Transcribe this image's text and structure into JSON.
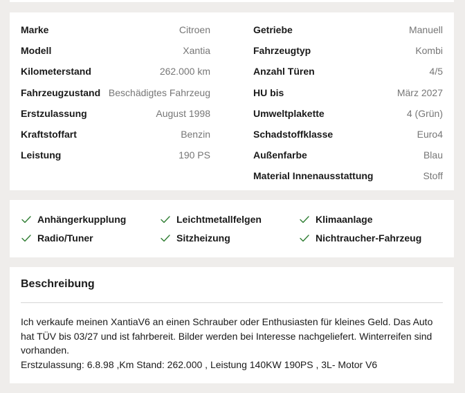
{
  "details": {
    "left": [
      {
        "label": "Marke",
        "value": "Citroen"
      },
      {
        "label": "Modell",
        "value": "Xantia"
      },
      {
        "label": "Kilometerstand",
        "value": "262.000 km"
      },
      {
        "label": "Fahrzeugzustand",
        "value": "Beschädigtes Fahrzeug"
      },
      {
        "label": "Erstzulassung",
        "value": "August 1998"
      },
      {
        "label": "Kraftstoffart",
        "value": "Benzin"
      },
      {
        "label": "Leistung",
        "value": "190 PS"
      }
    ],
    "right": [
      {
        "label": "Getriebe",
        "value": "Manuell"
      },
      {
        "label": "Fahrzeugtyp",
        "value": "Kombi"
      },
      {
        "label": "Anzahl Türen",
        "value": "4/5"
      },
      {
        "label": "HU bis",
        "value": "März 2027"
      },
      {
        "label": "Umweltplakette",
        "value": "4 (Grün)"
      },
      {
        "label": "Schadstoffklasse",
        "value": "Euro4"
      },
      {
        "label": "Außenfarbe",
        "value": "Blau"
      },
      {
        "label": "Material Innenausstattung",
        "value": "Stoff"
      }
    ]
  },
  "features": {
    "icon": "check-icon",
    "items": [
      "Anhängerkupplung",
      "Leichtmetallfelgen",
      "Klimaanlage",
      "Radio/Tuner",
      "Sitzheizung",
      "Nichtraucher-Fahrzeug"
    ]
  },
  "description": {
    "title": "Beschreibung",
    "paragraphs": [
      "Ich verkaufe meinen XantiaV6 an einen Schrauber oder Enthusiasten für kleines Geld. Das Auto hat TÜV bis 03/27 und ist fahrbereit. Bilder werden bei Interesse nachgeliefert. Winterreifen sind vorhanden.",
      "Erstzulassung: 6.8.98 ,Km Stand: 262.000 , Leistung 140KW 190PS , 3L- Motor V6"
    ]
  },
  "colors": {
    "page_background": "#efedeb",
    "card_background": "#ffffff",
    "check_green": "#2e7d32",
    "value_gray": "#767676"
  }
}
